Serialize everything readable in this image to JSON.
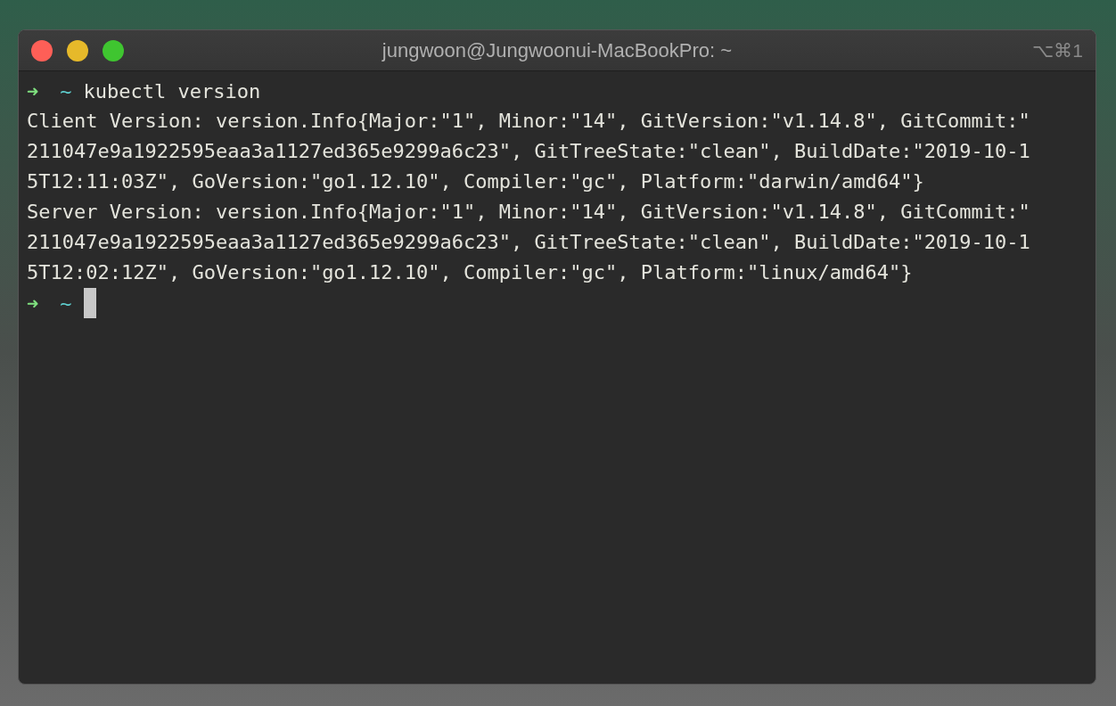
{
  "window": {
    "title": "jungwoon@Jungwoonui-MacBookPro: ~",
    "shortcut": "⌥⌘1"
  },
  "lines": [
    {
      "kind": "prompt",
      "arrow": "➜",
      "dir": "~",
      "command": "kubectl version",
      "cursor": false
    },
    {
      "kind": "output",
      "text": "Client Version: version.Info{Major:\"1\", Minor:\"14\", GitVersion:\"v1.14.8\", GitCommit:\""
    },
    {
      "kind": "output",
      "text": "211047e9a1922595eaa3a1127ed365e9299a6c23\", GitTreeState:\"clean\", BuildDate:\"2019-10-1"
    },
    {
      "kind": "output",
      "text": "5T12:11:03Z\", GoVersion:\"go1.12.10\", Compiler:\"gc\", Platform:\"darwin/amd64\"}"
    },
    {
      "kind": "output",
      "text": "Server Version: version.Info{Major:\"1\", Minor:\"14\", GitVersion:\"v1.14.8\", GitCommit:\""
    },
    {
      "kind": "output",
      "text": "211047e9a1922595eaa3a1127ed365e9299a6c23\", GitTreeState:\"clean\", BuildDate:\"2019-10-1"
    },
    {
      "kind": "output",
      "text": "5T12:02:12Z\", GoVersion:\"go1.12.10\", Compiler:\"gc\", Platform:\"linux/amd64\"}"
    },
    {
      "kind": "prompt",
      "arrow": "➜",
      "dir": "~",
      "cursor": true
    }
  ]
}
